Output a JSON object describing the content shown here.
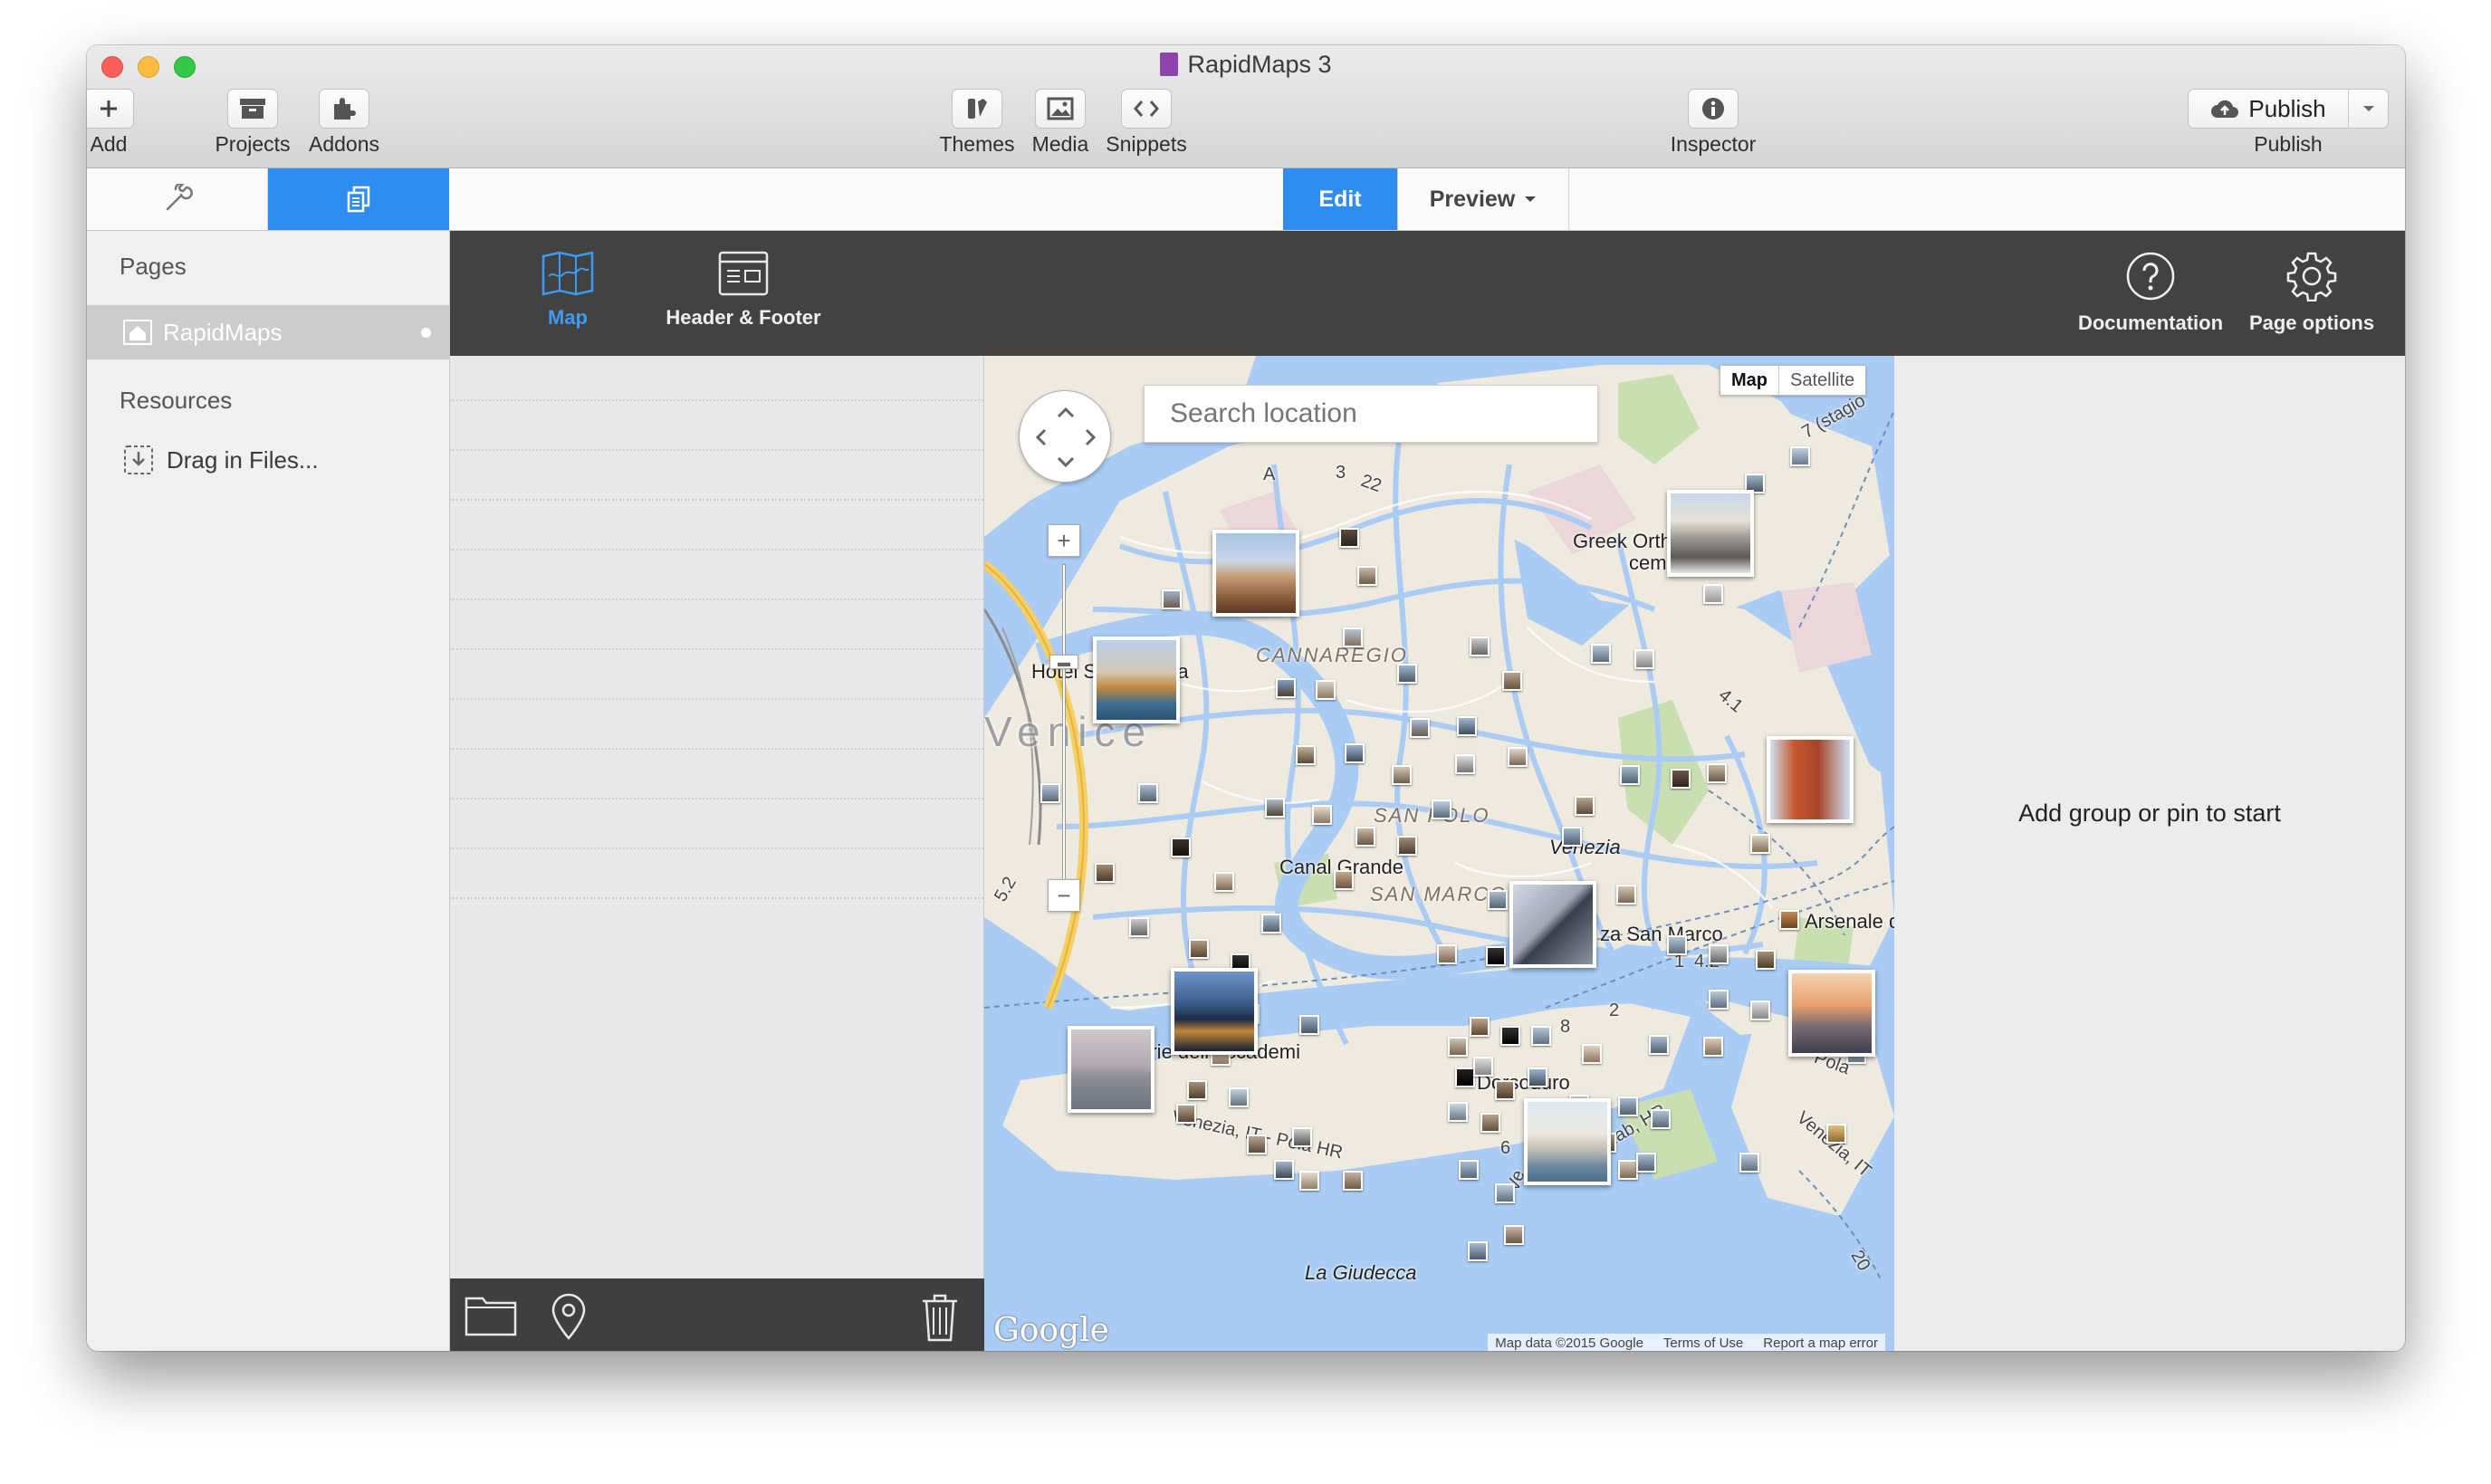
{
  "window": {
    "title": "RapidMaps 3"
  },
  "toolbar": {
    "add": "Add",
    "projects": "Projects",
    "addons": "Addons",
    "themes": "Themes",
    "media": "Media",
    "snippets": "Snippets",
    "inspector": "Inspector",
    "publish_button": "Publish",
    "publish_label": "Publish"
  },
  "modes": {
    "edit": "Edit",
    "preview": "Preview",
    "active": "Edit"
  },
  "sidebar": {
    "pages_heading": "Pages",
    "page_name": "RapidMaps",
    "resources_heading": "Resources",
    "drag_label": "Drag in Files..."
  },
  "editor_bar": {
    "map_tab": "Map",
    "header_footer_tab": "Header & Footer",
    "documentation": "Documentation",
    "page_options": "Page options",
    "active_tab": "Map"
  },
  "map": {
    "search_placeholder": "Search location",
    "type_map": "Map",
    "type_satellite": "Satellite",
    "active_type": "Map",
    "labels": {
      "venice": "Venice",
      "cannaregio": "CANNAREGIO",
      "san_polo": "SAN POLO",
      "san_marco": "SAN MARCO",
      "canal_grande": "Canal Grande",
      "hotel": "Hotel Santa Lucia",
      "greek_orth": "Greek Orth",
      "cem": "cem",
      "venezia": "Venezia",
      "piazza": "za San Marco",
      "arsenale": "Arsenale d",
      "gallerie": "Gallerie dell'Accademi",
      "dorsoduro": "Dorsoduro",
      "giudecca": "La Giudecca",
      "route_vpl": "Venezia, IT - Pola HR",
      "route_pola": "Pola",
      "route_vit": "Venezia, IT",
      "route_rab": "Rab, HR",
      "route_ve": "Ve",
      "route_7": "7 (stagio",
      "n_a": "A",
      "n_3": "3",
      "n_22": "22",
      "n_41": "4.1",
      "n_52": "5.2",
      "n_1": "1",
      "n_42": "4.2",
      "n_8": "8",
      "n_6": "6",
      "n_2": "2",
      "n_20": "20"
    },
    "google": "Google",
    "attribution_data": "Map data ©2015 Google",
    "attribution_terms": "Terms of Use",
    "attribution_report": "Report a map error"
  },
  "inspector": {
    "empty_message": "Add group or pin to start"
  },
  "colors": {
    "accent": "#2f8cf0",
    "water": "#a9cbf4",
    "land": "#eeeadf",
    "dark_bar": "#424242"
  }
}
